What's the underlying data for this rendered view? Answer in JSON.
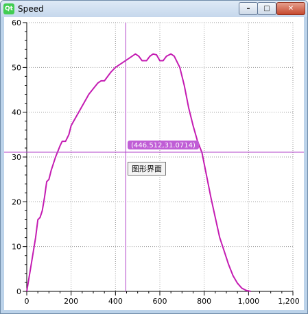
{
  "window": {
    "title": "Speed",
    "app_icon_text": "Qt",
    "buttons": {
      "minimize": "–",
      "maximize": "□",
      "close": "✕"
    }
  },
  "tooltip": {
    "text": "图形界面"
  },
  "crosshair": {
    "label": "(446.512,31.0714)",
    "x": 446.512,
    "y": 31.0714
  },
  "colors": {
    "series": "#c41cb2",
    "crosshair": "#b040c8",
    "label_bg": "#c05ed6"
  },
  "chart_data": {
    "type": "line",
    "title": "",
    "xlabel": "",
    "ylabel": "",
    "xlim": [
      0,
      1200
    ],
    "ylim": [
      0,
      60
    ],
    "grid": true,
    "legend": "none",
    "x_ticks": [
      0,
      200,
      400,
      600,
      800,
      1000,
      1200
    ],
    "x_tick_labels": [
      "0",
      "200",
      "400",
      "600",
      "800",
      "1,000",
      "1,200"
    ],
    "y_ticks": [
      0,
      10,
      20,
      30,
      40,
      50,
      60
    ],
    "y_tick_labels": [
      "0",
      "10",
      "20",
      "30",
      "40",
      "50",
      "60"
    ],
    "series": [
      {
        "values": [
          [
            0,
            0
          ],
          [
            20,
            6
          ],
          [
            40,
            12
          ],
          [
            50,
            16
          ],
          [
            60,
            16.5
          ],
          [
            70,
            18
          ],
          [
            80,
            21
          ],
          [
            90,
            24.5
          ],
          [
            100,
            25
          ],
          [
            110,
            27
          ],
          [
            130,
            30
          ],
          [
            150,
            32.5
          ],
          [
            160,
            33.5
          ],
          [
            175,
            33.5
          ],
          [
            190,
            35
          ],
          [
            200,
            37
          ],
          [
            240,
            40.5
          ],
          [
            280,
            44
          ],
          [
            320,
            46.5
          ],
          [
            335,
            47
          ],
          [
            350,
            47
          ],
          [
            380,
            49
          ],
          [
            400,
            50
          ],
          [
            430,
            51
          ],
          [
            460,
            52
          ],
          [
            490,
            53
          ],
          [
            505,
            52.5
          ],
          [
            520,
            51.5
          ],
          [
            540,
            51.5
          ],
          [
            555,
            52.5
          ],
          [
            570,
            53
          ],
          [
            585,
            52.8
          ],
          [
            600,
            51.5
          ],
          [
            615,
            51.5
          ],
          [
            630,
            52.5
          ],
          [
            650,
            53
          ],
          [
            665,
            52.5
          ],
          [
            690,
            50
          ],
          [
            710,
            46
          ],
          [
            730,
            41
          ],
          [
            750,
            37
          ],
          [
            770,
            33.5
          ],
          [
            790,
            31
          ],
          [
            810,
            26
          ],
          [
            830,
            21
          ],
          [
            850,
            16.5
          ],
          [
            870,
            12
          ],
          [
            890,
            9
          ],
          [
            910,
            6
          ],
          [
            930,
            3.5
          ],
          [
            950,
            1.8
          ],
          [
            970,
            0.7
          ],
          [
            990,
            0.2
          ],
          [
            1010,
            0
          ]
        ]
      }
    ]
  }
}
